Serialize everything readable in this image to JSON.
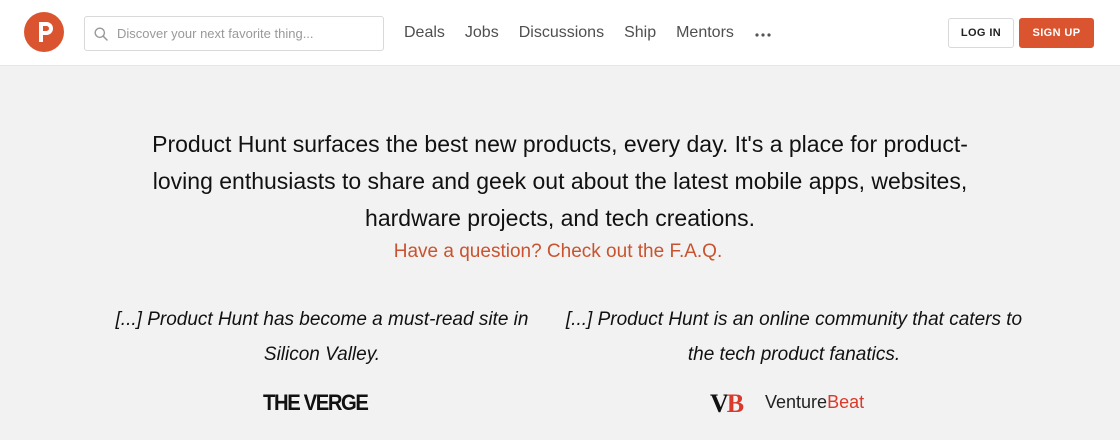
{
  "header": {
    "search": {
      "placeholder": "Discover your next favorite thing..."
    },
    "nav": [
      {
        "label": "Deals"
      },
      {
        "label": "Jobs"
      },
      {
        "label": "Discussions"
      },
      {
        "label": "Ship"
      },
      {
        "label": "Mentors"
      }
    ],
    "login_label": "LOG IN",
    "signup_label": "SIGN UP"
  },
  "main": {
    "intro": "Product Hunt surfaces the best new products, every day. It's a place for product-loving enthusiasts to share and geek out about the latest mobile apps, websites, hardware projects, and tech creations.",
    "faq_link": "Have a question? Check out the F.A.Q.",
    "quotes": [
      {
        "text": "[...] Product Hunt has become a must-read site in Silicon Valley.",
        "source": "THE VERGE"
      },
      {
        "text": "[...] Product Hunt is an online community that caters to the tech product fanatics.",
        "source_mark_v": "V",
        "source_mark_b": "B",
        "source_name_a": "Venture",
        "source_name_b": "Beat"
      }
    ]
  },
  "colors": {
    "brand": "#da552f",
    "link": "#c9532e",
    "background": "#f2f2f2",
    "venturebeat_red": "#d93a2b"
  },
  "icons": [
    "product-hunt-logo-icon",
    "search-icon",
    "more-dots-icon"
  ]
}
